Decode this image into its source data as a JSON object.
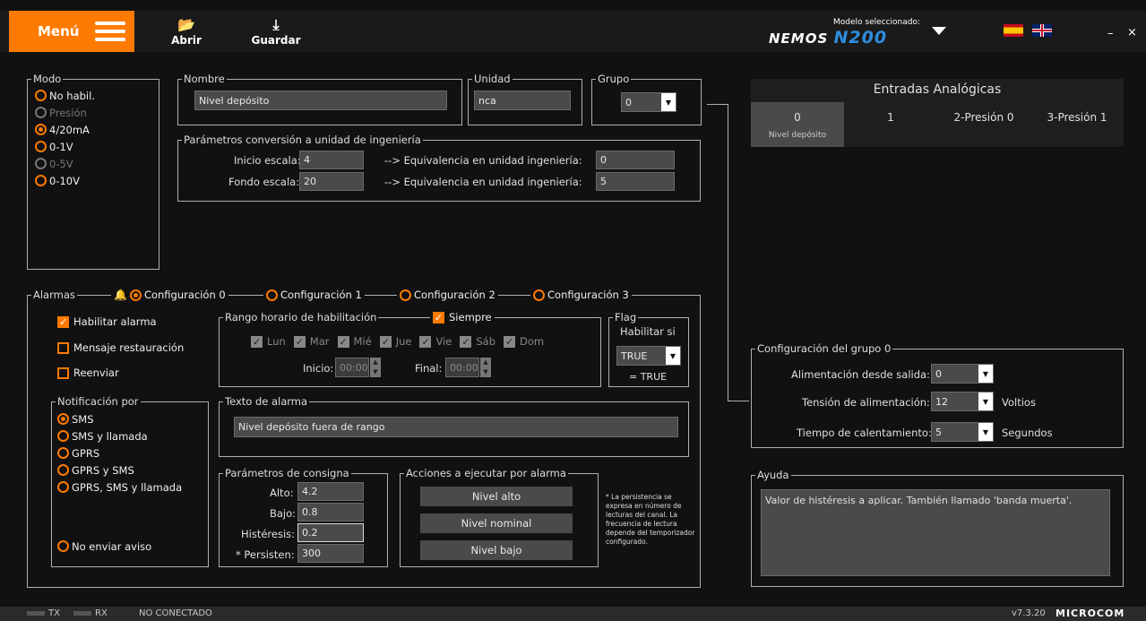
{
  "toolbar": {
    "menu_label": "Menú",
    "open_label": "Abrir",
    "save_label": "Guardar",
    "model_label": "Modelo seleccionado:",
    "model_name_prefix": "NEMOS",
    "model_name": "N200",
    "minimize": "–",
    "close": "×"
  },
  "modo": {
    "legend": "Modo",
    "options": [
      {
        "label": "No habil.",
        "selected": false,
        "disabled": false
      },
      {
        "label": "Presión",
        "selected": false,
        "disabled": true
      },
      {
        "label": "4/20mA",
        "selected": true,
        "disabled": false
      },
      {
        "label": "0-1V",
        "selected": false,
        "disabled": false
      },
      {
        "label": "0-5V",
        "selected": false,
        "disabled": true
      },
      {
        "label": "0-10V",
        "selected": false,
        "disabled": false
      }
    ]
  },
  "nombre": {
    "legend": "Nombre",
    "value": "Nivel depósito"
  },
  "unidad": {
    "legend": "Unidad",
    "value": "nca"
  },
  "grupo": {
    "legend": "Grupo",
    "value": "0"
  },
  "conversion": {
    "legend": "Parámetros conversión a unidad de ingeniería",
    "inicio_label": "Inicio escala:",
    "inicio_value": "4",
    "fondo_label": "Fondo escala:",
    "fondo_value": "20",
    "equiv_label": "--> Equivalencia en unidad ingeniería:",
    "equiv1_value": "0",
    "equiv2_value": "5"
  },
  "alarmas": {
    "legend": "Alarmas",
    "configs": [
      "Configuración 0",
      "Configuración 1",
      "Configuración 2",
      "Configuración 3"
    ],
    "habilitar": "Habilitar alarma",
    "mensaje": "Mensaje restauración",
    "reenviar": "Reenviar"
  },
  "rango": {
    "legend": "Rango horario de habilitación",
    "siempre": "Siempre",
    "days": [
      "Lun",
      "Mar",
      "Mié",
      "Jue",
      "Vie",
      "Sáb",
      "Dom"
    ],
    "inicio_label": "Inicio:",
    "inicio_value": "00:00",
    "final_label": "Final:",
    "final_value": "00:00"
  },
  "flag": {
    "legend": "Flag",
    "habilitar_si": "Habilitar si",
    "value": "TRUE",
    "result": "= TRUE"
  },
  "notificacion": {
    "legend": "Notificación por",
    "options": [
      {
        "label": "SMS",
        "selected": true
      },
      {
        "label": "SMS y llamada",
        "selected": false
      },
      {
        "label": "GPRS",
        "selected": false
      },
      {
        "label": "GPRS y SMS",
        "selected": false
      },
      {
        "label": "GPRS, SMS y llamada",
        "selected": false
      }
    ],
    "no_enviar": "No enviar aviso"
  },
  "texto_alarma": {
    "legend": "Texto de alarma",
    "value": "Nivel depósito fuera de rango"
  },
  "consigna": {
    "legend": "Parámetros de consigna",
    "alto_label": "Alto:",
    "alto_value": "4.2",
    "bajo_label": "Bajo:",
    "bajo_value": "0.8",
    "histeresis_label": "Histéresis:",
    "histeresis_value": "0.2",
    "persisten_label": "* Persisten:",
    "persisten_value": "300"
  },
  "acciones": {
    "legend": "Acciones a ejecutar por alarma",
    "buttons": [
      "Nivel alto",
      "Nivel nominal",
      "Nivel bajo"
    ],
    "note": "* La persistencia se expresa en número de lecturas del canal. La frecuencia de lectura depende del temporizador configurado."
  },
  "entradas": {
    "title": "Entradas Analógicas",
    "tabs": [
      {
        "label": "0",
        "sub": "Nivel depósito",
        "active": true
      },
      {
        "label": "1",
        "sub": "",
        "active": false
      },
      {
        "label": "2-Presión 0",
        "sub": "",
        "active": false
      },
      {
        "label": "3-Presión 1",
        "sub": "",
        "active": false
      }
    ]
  },
  "grupo_config": {
    "legend": "Configuración del grupo 0",
    "alim_label": "Alimentación desde salida:",
    "alim_value": "0",
    "tension_label": "Tensión de alimentación:",
    "tension_value": "12",
    "tension_unit": "Voltios",
    "tiempo_label": "Tiempo de calentamiento:",
    "tiempo_value": "5",
    "tiempo_unit": "Segundos"
  },
  "ayuda": {
    "legend": "Ayuda",
    "text": "Valor de histéresis a aplicar. También llamado 'banda muerta'."
  },
  "status": {
    "tx": "TX",
    "rx": "RX",
    "connection": "NO CONECTADO",
    "version": "v7.3.20",
    "brand": "MICROCOM"
  },
  "colors": {
    "accent": "#ff7a00",
    "background": "#111111",
    "input": "#4a4a4a"
  }
}
